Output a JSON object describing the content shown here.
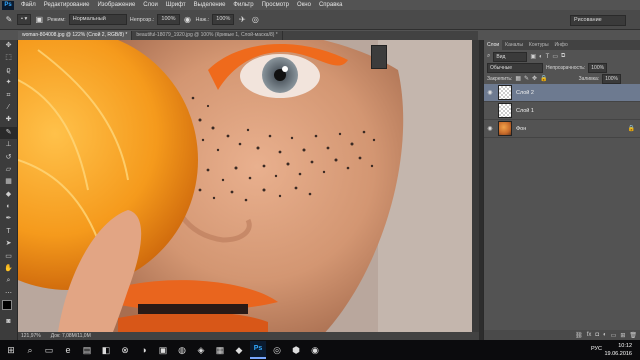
{
  "menu": [
    "Файл",
    "Редактирование",
    "Изображение",
    "Слои",
    "Шрифт",
    "Выделение",
    "Фильтр",
    "Просмотр",
    "Окно",
    "Справка"
  ],
  "logo": "Ps",
  "options": {
    "mode_label": "Режим:",
    "mode_value": "Нормальный",
    "opacity_label": "Непрозр.:",
    "opacity_value": "100%",
    "flow_label": "Наж.:",
    "flow_value": "100%",
    "workspace": "Рисование"
  },
  "tabs": [
    {
      "label": "woman-804008.jpg @ 122% (Слой 2, RGB/8) *",
      "active": true
    },
    {
      "label": "beautiful-18079_1920.jpg @ 100% (Кривые 1, Слой-маска/8) *",
      "active": false
    }
  ],
  "status": {
    "zoom": "121,97%",
    "doc": "Док: 7,08M/11,0M"
  },
  "panel": {
    "tabs": [
      "Слои",
      "Каналы",
      "Контуры",
      "Инфо"
    ],
    "filter_label": "Вид",
    "blend_mode": "Обычные",
    "opacity_label": "Непрозрачность:",
    "opacity_value": "100%",
    "lock_label": "Закрепить:",
    "fill_label": "Заливка:",
    "fill_value": "100%",
    "layers": [
      {
        "name": "Слой 2",
        "selected": true,
        "visible": true,
        "thumb": "transparent"
      },
      {
        "name": "Слой 1",
        "selected": false,
        "visible": false,
        "thumb": "transparent"
      },
      {
        "name": "Фон",
        "selected": false,
        "visible": true,
        "thumb": "photo"
      }
    ]
  },
  "taskbar": {
    "lang": "РУС",
    "time": "10:12",
    "date": "19.06.2016"
  },
  "icons": {
    "tools": [
      "move-icon",
      "marquee-icon",
      "lasso-icon",
      "quick-select-icon",
      "crop-icon",
      "eyedropper-icon",
      "healing-icon",
      "brush-icon",
      "stamp-icon",
      "history-brush-icon",
      "eraser-icon",
      "gradient-icon",
      "blur-icon",
      "dodge-icon",
      "pen-icon",
      "type-icon",
      "path-select-icon",
      "shape-icon",
      "hand-icon",
      "zoom-icon"
    ]
  }
}
